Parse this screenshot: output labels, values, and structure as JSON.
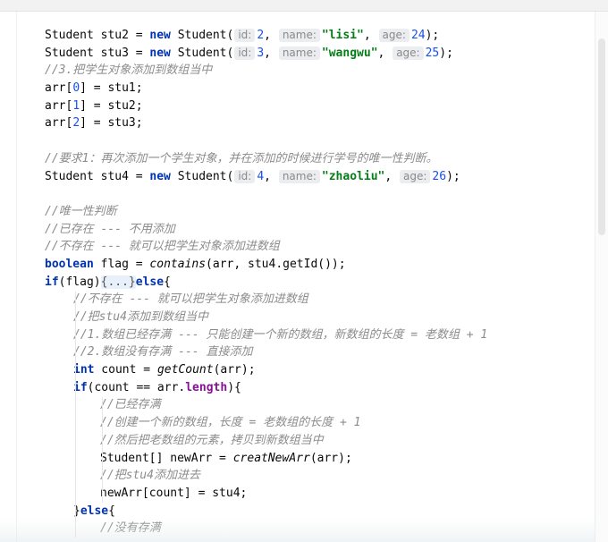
{
  "editor": {
    "lines": [
      {
        "indent": 50,
        "tokens": [
          {
            "t": "Student stu2 = ",
            "c": ""
          },
          {
            "t": "new",
            "c": "kw"
          },
          {
            "t": " Student(",
            "c": ""
          },
          {
            "t": "id:",
            "c": "hint"
          },
          {
            "t": "2",
            "c": "num"
          },
          {
            "t": ", ",
            "c": ""
          },
          {
            "t": "name:",
            "c": "hint"
          },
          {
            "t": "\"lisi\"",
            "c": "str"
          },
          {
            "t": ", ",
            "c": ""
          },
          {
            "t": "age:",
            "c": "hint"
          },
          {
            "t": "24",
            "c": "num"
          },
          {
            "t": ");",
            "c": ""
          }
        ]
      },
      {
        "indent": 50,
        "tokens": [
          {
            "t": "Student stu3 = ",
            "c": ""
          },
          {
            "t": "new",
            "c": "kw"
          },
          {
            "t": " Student(",
            "c": ""
          },
          {
            "t": "id:",
            "c": "hint"
          },
          {
            "t": "3",
            "c": "num"
          },
          {
            "t": ", ",
            "c": ""
          },
          {
            "t": "name:",
            "c": "hint"
          },
          {
            "t": "\"wangwu\"",
            "c": "str"
          },
          {
            "t": ", ",
            "c": ""
          },
          {
            "t": "age:",
            "c": "hint"
          },
          {
            "t": "25",
            "c": "num"
          },
          {
            "t": ");",
            "c": ""
          }
        ]
      },
      {
        "indent": 50,
        "tokens": [
          {
            "t": "//3.把学生对象添加到数组当中",
            "c": "cm"
          }
        ]
      },
      {
        "indent": 50,
        "tokens": [
          {
            "t": "arr[",
            "c": ""
          },
          {
            "t": "0",
            "c": "num"
          },
          {
            "t": "] = stu1;",
            "c": ""
          }
        ]
      },
      {
        "indent": 50,
        "tokens": [
          {
            "t": "arr[",
            "c": ""
          },
          {
            "t": "1",
            "c": "num"
          },
          {
            "t": "] = stu2;",
            "c": ""
          }
        ]
      },
      {
        "indent": 50,
        "tokens": [
          {
            "t": "arr[",
            "c": ""
          },
          {
            "t": "2",
            "c": "num"
          },
          {
            "t": "] = stu3;",
            "c": ""
          }
        ]
      },
      {
        "indent": 50,
        "tokens": []
      },
      {
        "indent": 50,
        "tokens": [
          {
            "t": "//要求1：再次添加一个学生对象，并在添加的时候进行学号的唯一性判断。",
            "c": "cm"
          }
        ]
      },
      {
        "indent": 50,
        "tokens": [
          {
            "t": "Student stu4 = ",
            "c": ""
          },
          {
            "t": "new",
            "c": "kw"
          },
          {
            "t": " Student(",
            "c": ""
          },
          {
            "t": "id:",
            "c": "hint"
          },
          {
            "t": "4",
            "c": "num"
          },
          {
            "t": ", ",
            "c": ""
          },
          {
            "t": "name:",
            "c": "hint"
          },
          {
            "t": "\"zhaoliu\"",
            "c": "str"
          },
          {
            "t": ", ",
            "c": ""
          },
          {
            "t": "age:",
            "c": "hint"
          },
          {
            "t": "26",
            "c": "num"
          },
          {
            "t": ");",
            "c": ""
          }
        ]
      },
      {
        "indent": 50,
        "tokens": []
      },
      {
        "indent": 50,
        "tokens": [
          {
            "t": "//唯一性判断",
            "c": "cm"
          }
        ]
      },
      {
        "indent": 50,
        "tokens": [
          {
            "t": "//已存在 --- 不用添加",
            "c": "cm"
          }
        ]
      },
      {
        "indent": 50,
        "tokens": [
          {
            "t": "//不存在 --- 就可以把学生对象添加进数组",
            "c": "cm"
          }
        ]
      },
      {
        "indent": 50,
        "tokens": [
          {
            "t": "boolean",
            "c": "kw"
          },
          {
            "t": " flag = ",
            "c": ""
          },
          {
            "t": "contains",
            "c": "mth"
          },
          {
            "t": "(arr, stu4.getId());",
            "c": ""
          }
        ]
      },
      {
        "indent": 50,
        "tokens": [
          {
            "t": "if",
            "c": "kw"
          },
          {
            "t": "(flag)",
            "c": ""
          },
          {
            "t": "{...}",
            "c": "fold"
          },
          {
            "t": "else",
            "c": "kw"
          },
          {
            "t": "{",
            "c": ""
          }
        ]
      },
      {
        "indent": 82,
        "tokens": [
          {
            "t": "//不存在 --- 就可以把学生对象添加进数组",
            "c": "cm"
          }
        ]
      },
      {
        "indent": 82,
        "tokens": [
          {
            "t": "//把stu4添加到数组当中",
            "c": "cm"
          }
        ]
      },
      {
        "indent": 82,
        "tokens": [
          {
            "t": "//1.数组已经存满 --- 只能创建一个新的数组，新数组的长度 = 老数组 + 1",
            "c": "cm"
          }
        ]
      },
      {
        "indent": 82,
        "tokens": [
          {
            "t": "//2.数组没有存满 --- 直接添加",
            "c": "cm"
          }
        ]
      },
      {
        "indent": 82,
        "tokens": [
          {
            "t": "int",
            "c": "kw"
          },
          {
            "t": " count = ",
            "c": ""
          },
          {
            "t": "getCount",
            "c": "mth"
          },
          {
            "t": "(arr);",
            "c": ""
          }
        ]
      },
      {
        "indent": 82,
        "tokens": [
          {
            "t": "if",
            "c": "kw"
          },
          {
            "t": "(count == arr.",
            "c": ""
          },
          {
            "t": "length",
            "c": "fld"
          },
          {
            "t": "){",
            "c": ""
          }
        ]
      },
      {
        "indent": 112,
        "tokens": [
          {
            "t": "//已经存满",
            "c": "cm"
          }
        ]
      },
      {
        "indent": 112,
        "tokens": [
          {
            "t": "//创建一个新的数组，长度 = 老数组的长度 + 1",
            "c": "cm"
          }
        ]
      },
      {
        "indent": 112,
        "tokens": [
          {
            "t": "//然后把老数组的元素，拷贝到新数组当中",
            "c": "cm"
          }
        ]
      },
      {
        "indent": 112,
        "tokens": [
          {
            "t": "Student[] newArr = ",
            "c": ""
          },
          {
            "t": "creatNewArr",
            "c": "mth"
          },
          {
            "t": "(arr);",
            "c": ""
          }
        ]
      },
      {
        "indent": 112,
        "tokens": [
          {
            "t": "//把stu4添加进去",
            "c": "cm"
          }
        ]
      },
      {
        "indent": 112,
        "tokens": [
          {
            "t": "newArr[count] = stu4;",
            "c": ""
          }
        ]
      },
      {
        "indent": 82,
        "tokens": [
          {
            "t": "}",
            "c": ""
          },
          {
            "t": "else",
            "c": "kw"
          },
          {
            "t": "{",
            "c": ""
          }
        ]
      },
      {
        "indent": 112,
        "tokens": [
          {
            "t": "//没有存满",
            "c": "cm"
          }
        ]
      }
    ]
  }
}
